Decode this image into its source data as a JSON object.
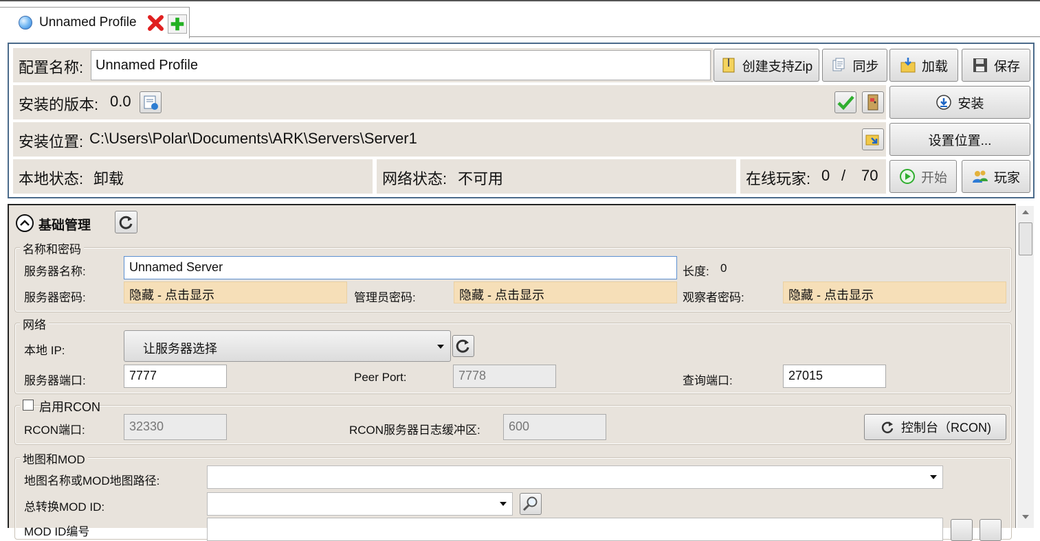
{
  "tab": {
    "title": "Unnamed Profile"
  },
  "header": {
    "profile_label": "配置名称:",
    "profile_value": "Unnamed Profile",
    "btn_support_zip": "创建支持Zip",
    "btn_sync": "同步",
    "btn_load": "加载",
    "btn_save": "保存",
    "installed_version_label": "安装的版本:",
    "installed_version_value": "0.0",
    "btn_install": "安装",
    "install_location_label": "安装位置:",
    "install_location_value": "C:\\Users\\Polar\\Documents\\ARK\\Servers\\Server1",
    "btn_set_location": "设置位置...",
    "local_status_label": "本地状态:",
    "local_status_value": "卸载",
    "network_status_label": "网络状态:",
    "network_status_value": "不可用",
    "online_players_label": "在线玩家:",
    "online_players_current": "0",
    "online_players_sep": "/",
    "online_players_max": "70",
    "btn_start": "开始",
    "btn_players": "玩家"
  },
  "basic": {
    "section_title": "基础管理",
    "name_pw_group": "名称和密码",
    "server_name_label": "服务器名称:",
    "server_name_value": "Unnamed Server",
    "length_label": "长度:",
    "length_value": "0",
    "server_pw_label": "服务器密码:",
    "server_pw_value": "隐藏 - 点击显示",
    "admin_pw_label": "管理员密码:",
    "admin_pw_value": "隐藏 - 点击显示",
    "spectator_pw_label": "观察者密码:",
    "spectator_pw_value": "隐藏 - 点击显示",
    "network_group": "网络",
    "local_ip_label": "本地 IP:",
    "local_ip_value": "让服务器选择",
    "server_port_label": "服务器端口:",
    "server_port_value": "7777",
    "peer_port_label": "Peer Port:",
    "peer_port_value": "7778",
    "query_port_label": "查询端口:",
    "query_port_value": "27015",
    "rcon_enable_label": "启用RCON",
    "rcon_port_label": "RCON端口:",
    "rcon_port_value": "32330",
    "rcon_buffer_label": "RCON服务器日志缓冲区:",
    "rcon_buffer_value": "600",
    "rcon_console_button": "控制台（RCON)",
    "map_mod_group": "地图和MOD",
    "map_label": "地图名称或MOD地图路径:",
    "map_value": "",
    "total_conversion_label": "总转换MOD ID:",
    "total_conversion_value": "",
    "mod_ids_label": "MOD ID编号"
  },
  "colors": {
    "panel_bg": "#e8e3dc",
    "password_bg": "#f6dfb8",
    "header_border": "#4a6a8a",
    "check_green": "#2fae2f"
  }
}
